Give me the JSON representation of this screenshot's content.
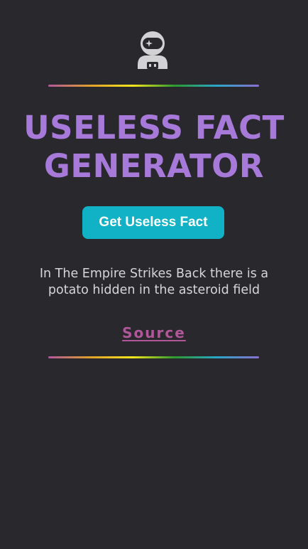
{
  "header": {
    "logo_icon": "astronaut-icon"
  },
  "main": {
    "title": "USELESS FACT GENERATOR",
    "button_label": "Get Useless Fact",
    "fact_text": "In The Empire Strikes Back there is a potato hidden in the asteroid field",
    "source_label": "Source"
  },
  "colors": {
    "background": "#29282d",
    "title": "#a77ad9",
    "button": "#11b2c6",
    "link": "#b0579a",
    "text": "#d6d6d6"
  }
}
